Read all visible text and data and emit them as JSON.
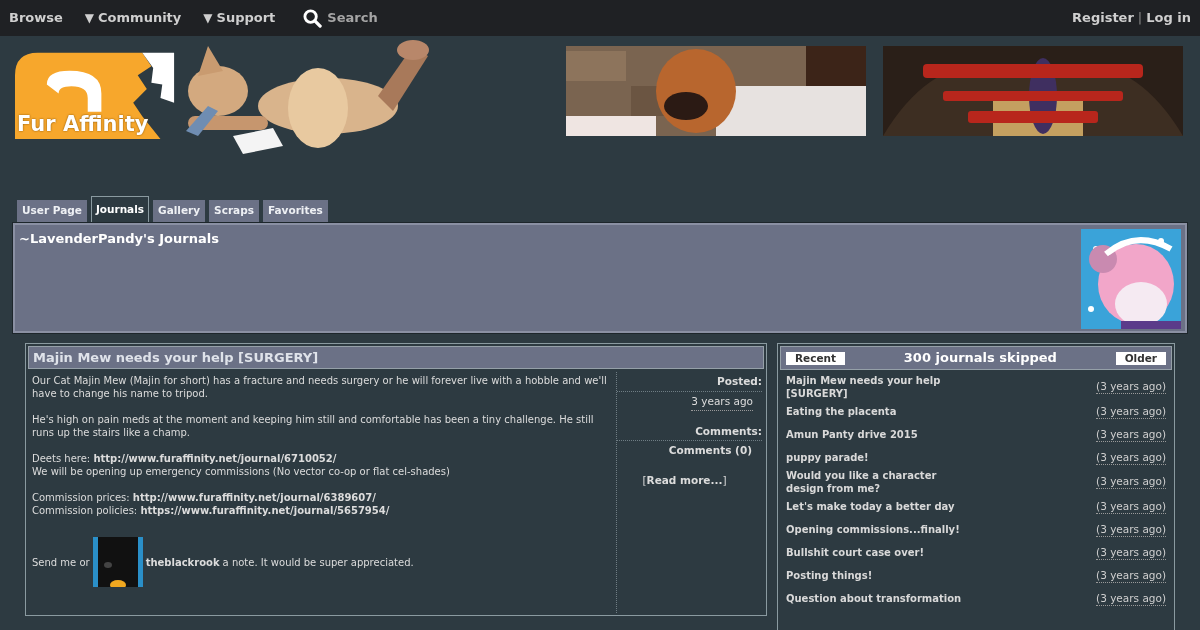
{
  "nav": {
    "left": [
      {
        "label": "Browse",
        "kind": "link"
      },
      {
        "label": "Community",
        "kind": "dropdown",
        "caret": "▼"
      },
      {
        "label": "Support",
        "kind": "dropdown",
        "caret": "▼"
      },
      {
        "label": "Search",
        "kind": "search"
      }
    ],
    "right": [
      {
        "label": "Register"
      },
      {
        "label": "Log in"
      }
    ],
    "separator": "|"
  },
  "logo": {
    "text": "Fur Affinity"
  },
  "tabs": [
    {
      "label": "User Page",
      "selected": false
    },
    {
      "label": "Journals",
      "selected": true
    },
    {
      "label": "Gallery",
      "selected": false
    },
    {
      "label": "Scraps",
      "selected": false
    },
    {
      "label": "Favorites",
      "selected": false
    }
  ],
  "user_header": {
    "title": "~LavenderPandy's Journals"
  },
  "journal": {
    "title": "Majin Mew needs your help [SURGERY]",
    "paragraphs": [
      [
        "Our Cat Majin Mew (Majin for short) has a fracture and needs surgery or he will forever live with a hobble and we'll have to change his name to tripod."
      ],
      [
        "He's high on pain meds at the moment and keeping him still and comfortable has been a tiny challenge. He still runs up the stairs like a champ."
      ],
      [
        "Deets here: **http://www.furaffinity.net/journal/6710052/**",
        "We will be opening up emergency commissions (No vector co-op or flat cel-shades)"
      ],
      [
        "Commission prices: **http://www.furaffinity.net/journal/6389607/**",
        "Commission policies: **https://www.furaffinity.net/journal/5657954/**"
      ]
    ],
    "note": {
      "before": "Send me or",
      "user": "theblackrook",
      "after": "a note. It would be super appreciated."
    },
    "posted_label": "Posted:",
    "posted": "3 years ago",
    "comments_label": "Comments:",
    "comments": "Comments (0)",
    "read_more": "Read more...",
    "bracket_open": "[",
    "bracket_close": "]"
  },
  "journal_list": {
    "recent": "Recent",
    "older": "Older",
    "heading": "300 journals skipped",
    "items": [
      {
        "title": "Majin Mew needs your help [SURGERY]",
        "time": "(3 years ago)"
      },
      {
        "title": "Eating the placenta",
        "time": "(3 years ago)"
      },
      {
        "title": "Amun Panty drive 2015",
        "time": "(3 years ago)"
      },
      {
        "title": "puppy parade!",
        "time": "(3 years ago)"
      },
      {
        "title": "Would you like a character design from me?",
        "time": "(3 years ago)"
      },
      {
        "title": "Let's make today a better day",
        "time": "(3 years ago)"
      },
      {
        "title": "Opening commissions...finally!",
        "time": "(3 years ago)"
      },
      {
        "title": "Bullshit court case over!",
        "time": "(3 years ago)"
      },
      {
        "title": "Posting things!",
        "time": "(3 years ago)"
      },
      {
        "title": "Question about transformation",
        "time": "(3 years ago)"
      }
    ]
  }
}
